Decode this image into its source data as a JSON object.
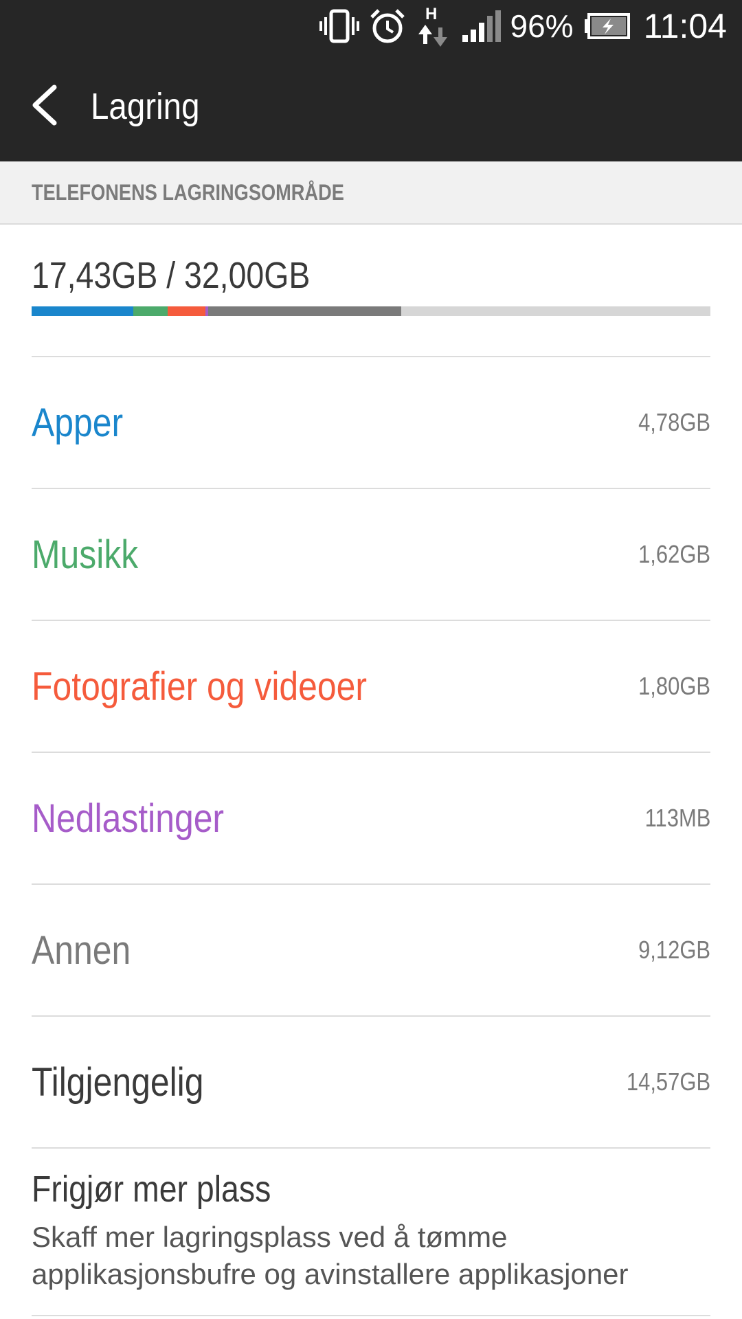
{
  "status_bar": {
    "battery_percent_text": "96%",
    "time": "11:04",
    "network_type": "H",
    "icons": [
      "vibrate-icon",
      "alarm-icon",
      "data-transfer-icon",
      "signal-icon",
      "battery-charging-icon"
    ]
  },
  "app_bar": {
    "title": "Lagring",
    "back_icon": "back-arrow-icon"
  },
  "storage": {
    "section_header": "TELEFONENS LAGRINGSOMRÅDE",
    "usage_text": "17,43GB / 32,00GB",
    "total_gb": 32.0,
    "used_gb": 17.43,
    "categories": [
      {
        "label": "Apper",
        "value": "4,78GB",
        "gb": 4.78,
        "color": "#1a86cc"
      },
      {
        "label": "Musikk",
        "value": "1,62GB",
        "gb": 1.62,
        "color": "#4caa6b"
      },
      {
        "label": "Fotografier og videoer",
        "value": "1,80GB",
        "gb": 1.8,
        "color": "#f55b3c"
      },
      {
        "label": "Nedlastinger",
        "value": "113MB",
        "gb": 0.113,
        "color": "#a65cc9"
      },
      {
        "label": "Annen",
        "value": "9,12GB",
        "gb": 9.12,
        "color": "#7a7a7a"
      },
      {
        "label": "Tilgjengelig",
        "value": "14,57GB",
        "gb": 14.57,
        "color": "#3a3a3a"
      }
    ],
    "bar_remaining_color": "#d6d6d6"
  },
  "free_space": {
    "title": "Frigjør mer plass",
    "description": "Skaff mer lagringsplass ved å tømme applikasjonsbufre og avinstallere applikasjoner"
  }
}
